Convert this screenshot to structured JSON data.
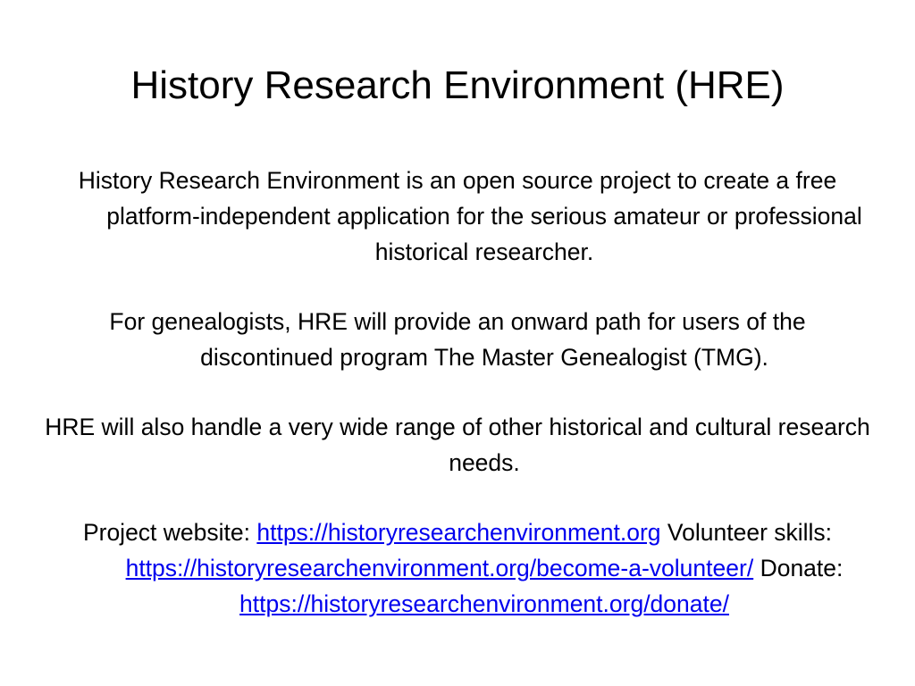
{
  "slide": {
    "title": "History Research Environment (HRE)",
    "paragraphs": [
      "History Research Environment is an open source project to create a free platform-independent application for the serious amateur or professional historical researcher.",
      "For genealogists, HRE will provide an onward path for users of the discontinued program The Master Genealogist (TMG).",
      "HRE will also handle a very wide range of other historical and cultural research needs."
    ],
    "links": {
      "website_label": "Project website: ",
      "website_url": "https://historyresearchenvironment.org",
      "volunteer_label": "Volunteer skills: ",
      "volunteer_url": "https://historyresearchenvironment.org/become-a-volunteer/",
      "donate_label": "Donate: ",
      "donate_url": "https://historyresearchenvironment.org/donate/"
    },
    "colors": {
      "text": "#000000",
      "link": "#0000ee",
      "background": "#ffffff"
    }
  }
}
